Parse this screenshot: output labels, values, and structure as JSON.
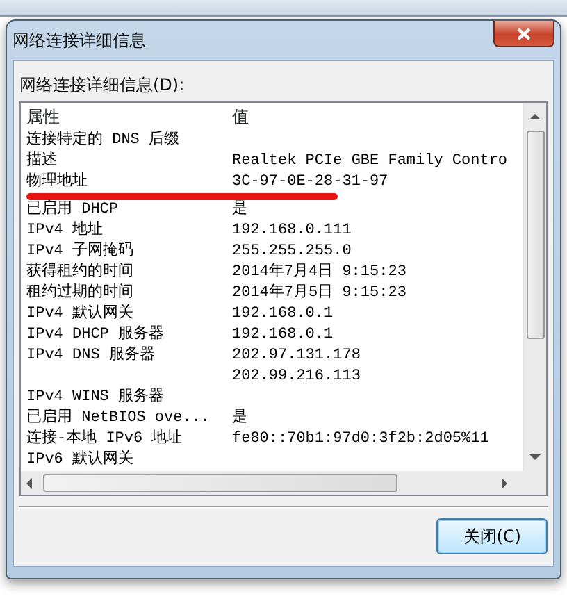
{
  "window": {
    "title": "网络连接详细信息"
  },
  "list_label": "网络连接详细信息(D):",
  "columns": [
    "属性",
    "值"
  ],
  "rows": [
    {
      "property": "连接特定的 DNS 后缀",
      "value": "",
      "underlined": false
    },
    {
      "property": "描述",
      "value": "Realtek PCIe GBE Family Contro",
      "underlined": false
    },
    {
      "property": "物理地址",
      "value": "3C-97-0E-28-31-97",
      "underlined": true
    },
    {
      "property": "已启用 DHCP",
      "value": "是",
      "underlined": false
    },
    {
      "property": "IPv4 地址",
      "value": "192.168.0.111",
      "underlined": false
    },
    {
      "property": "IPv4 子网掩码",
      "value": "255.255.255.0",
      "underlined": false
    },
    {
      "property": "获得租约的时间",
      "value": "2014年7月4日 9:15:23",
      "underlined": false
    },
    {
      "property": "租约过期的时间",
      "value": "2014年7月5日 9:15:23",
      "underlined": false
    },
    {
      "property": "IPv4 默认网关",
      "value": "192.168.0.1",
      "underlined": false
    },
    {
      "property": "IPv4 DHCP 服务器",
      "value": "192.168.0.1",
      "underlined": false
    },
    {
      "property": "IPv4 DNS 服务器",
      "value": "202.97.131.178",
      "underlined": false
    },
    {
      "property": "",
      "value": "202.99.216.113",
      "underlined": false
    },
    {
      "property": "IPv4 WINS 服务器",
      "value": "",
      "underlined": false
    },
    {
      "property": "已启用 NetBIOS ove...",
      "value": "是",
      "underlined": false
    },
    {
      "property": "连接-本地 IPv6 地址",
      "value": "fe80::70b1:97d0:3f2b:2d05%11",
      "underlined": false
    },
    {
      "property": "IPv6 默认网关",
      "value": "",
      "underlined": false
    }
  ],
  "buttons": [
    {
      "label": "关闭(C)",
      "default": true
    }
  ]
}
